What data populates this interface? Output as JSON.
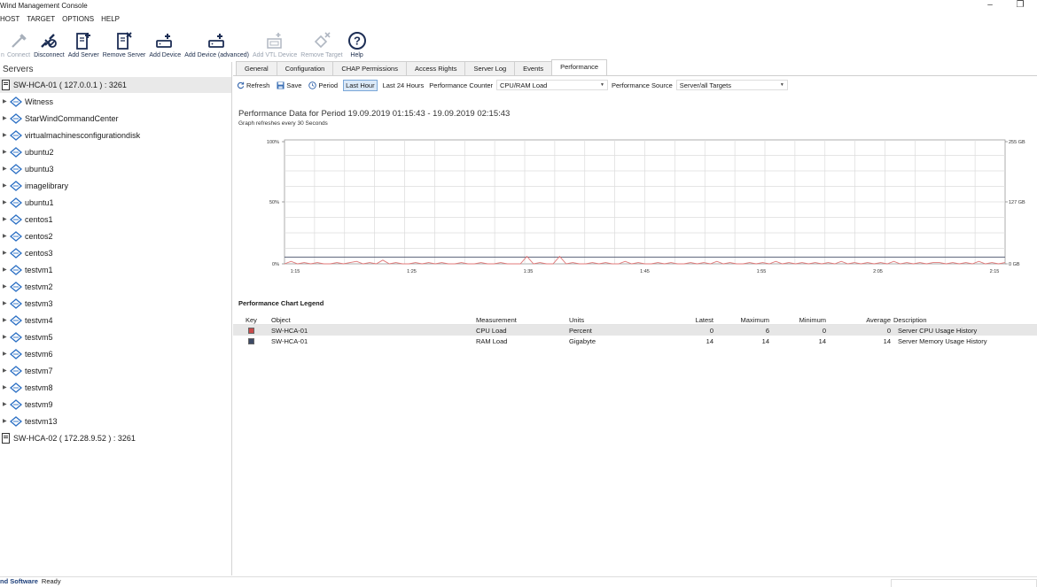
{
  "window": {
    "title": "Wind Management Console",
    "minimize": "–",
    "restore": "❐"
  },
  "menu": [
    "HOST",
    "TARGET",
    "OPTIONS",
    "HELP"
  ],
  "toolbar": {
    "items": [
      {
        "label": "n",
        "icon": "connect-icon",
        "enabled": false
      },
      {
        "label": "Connect",
        "icon": "connect-icon",
        "enabled": false
      },
      {
        "label": "Disconnect",
        "icon": "disconnect-icon",
        "enabled": true
      },
      {
        "label": "Add Server",
        "icon": "add-server-icon",
        "enabled": true
      },
      {
        "label": "Remove Server",
        "icon": "remove-server-icon",
        "enabled": true
      },
      {
        "label": "Add Device",
        "icon": "add-device-icon",
        "enabled": true
      },
      {
        "label": "Add Device (advanced)",
        "icon": "add-device-advanced-icon",
        "enabled": true
      },
      {
        "label": "Add VTL Device",
        "icon": "add-vtl-device-icon",
        "enabled": false
      },
      {
        "label": "Remove Target",
        "icon": "remove-target-icon",
        "enabled": false
      },
      {
        "label": "Help",
        "icon": "help-icon",
        "enabled": true
      }
    ]
  },
  "tree": {
    "header": "Servers",
    "root": "SW-HCA-01 ( 127.0.0.1 ) : 3261",
    "targets": [
      "Witness",
      "StarWindCommandCenter",
      "virtualmachinesconfigurationdisk",
      "ubuntu2",
      "ubuntu3",
      "imagelibrary",
      "ubuntu1",
      "centos1",
      "centos2",
      "centos3",
      "testvm1",
      "testvm2",
      "testvm3",
      "testvm4",
      "testvm5",
      "testvm6",
      "testvm7",
      "testvm8",
      "testvm9",
      "testvm13"
    ],
    "second_server": "SW-HCA-02 ( 172.28.9.52 ) : 3261"
  },
  "tabs": [
    "General",
    "Configuration",
    "CHAP Permissions",
    "Access Rights",
    "Server Log",
    "Events",
    "Performance"
  ],
  "active_tab": "Performance",
  "perf_toolbar": {
    "refresh": "Refresh",
    "save": "Save",
    "period": "Period",
    "last_hour": "Last Hour",
    "last_24": "Last 24 Hours",
    "counter_label": "Performance Counter",
    "counter_value": "CPU/RAM Load",
    "source_label": "Performance Source",
    "source_value": "Server/all Targets"
  },
  "perf_header": {
    "title": "Performance Data for Period 19.09.2019 01:15:43 - 19.09.2019 02:15:43",
    "subtitle": "Graph refreshes every 30 Seconds"
  },
  "chart_data": {
    "type": "line",
    "x_ticks": [
      "1:15",
      "1:25",
      "1:35",
      "1:45",
      "1:55",
      "2:05",
      "2:15"
    ],
    "y_left_ticks": [
      "100%",
      "50%",
      "0%"
    ],
    "y_right_ticks": [
      "255 GB",
      "127 GB",
      "0 GB"
    ],
    "grid": true,
    "series": [
      {
        "name": "CPU Load",
        "color": "#e07878",
        "values": [
          0,
          2,
          0,
          1,
          0,
          1,
          0,
          0,
          1,
          0,
          1,
          2,
          0,
          1,
          0,
          3,
          0,
          1,
          0,
          0,
          1,
          0,
          1,
          0,
          1,
          0,
          0,
          1,
          0,
          0,
          1,
          0,
          0,
          1,
          0,
          0,
          0,
          6,
          0,
          1,
          0,
          0,
          6,
          0,
          1,
          0,
          0,
          1,
          0,
          1,
          0,
          0,
          2,
          0,
          1,
          0,
          0,
          1,
          0,
          1,
          0,
          0,
          1,
          0,
          1,
          0,
          2,
          0,
          1,
          0,
          0,
          1,
          0,
          1,
          0,
          2,
          0,
          1,
          0,
          1,
          0,
          1,
          0,
          1,
          0,
          2,
          0,
          1,
          0,
          1,
          0,
          1,
          0,
          2,
          0,
          1,
          0,
          1,
          0,
          1,
          1,
          0,
          1,
          0,
          1,
          0,
          2,
          0,
          1,
          0,
          1
        ]
      },
      {
        "name": "RAM Load",
        "color": "#5a6278",
        "values_gb": 14
      }
    ]
  },
  "legend": {
    "title": "Performance Chart Legend",
    "columns": [
      "Key",
      "Object",
      "Measurement",
      "Units",
      "Latest",
      "Maximum",
      "Minimum",
      "Average",
      "Description"
    ],
    "rows": [
      {
        "color": "#c94a4a",
        "object": "SW-HCA-01",
        "measurement": "CPU Load",
        "units": "Percent",
        "latest": "0",
        "maximum": "6",
        "minimum": "0",
        "average": "0",
        "description": "Server CPU Usage History"
      },
      {
        "color": "#3d4a66",
        "object": "SW-HCA-01",
        "measurement": "RAM Load",
        "units": "Gigabyte",
        "latest": "14",
        "maximum": "14",
        "minimum": "14",
        "average": "14",
        "description": "Server Memory Usage History"
      }
    ]
  },
  "status": {
    "company": "nd Software",
    "state": "Ready"
  }
}
